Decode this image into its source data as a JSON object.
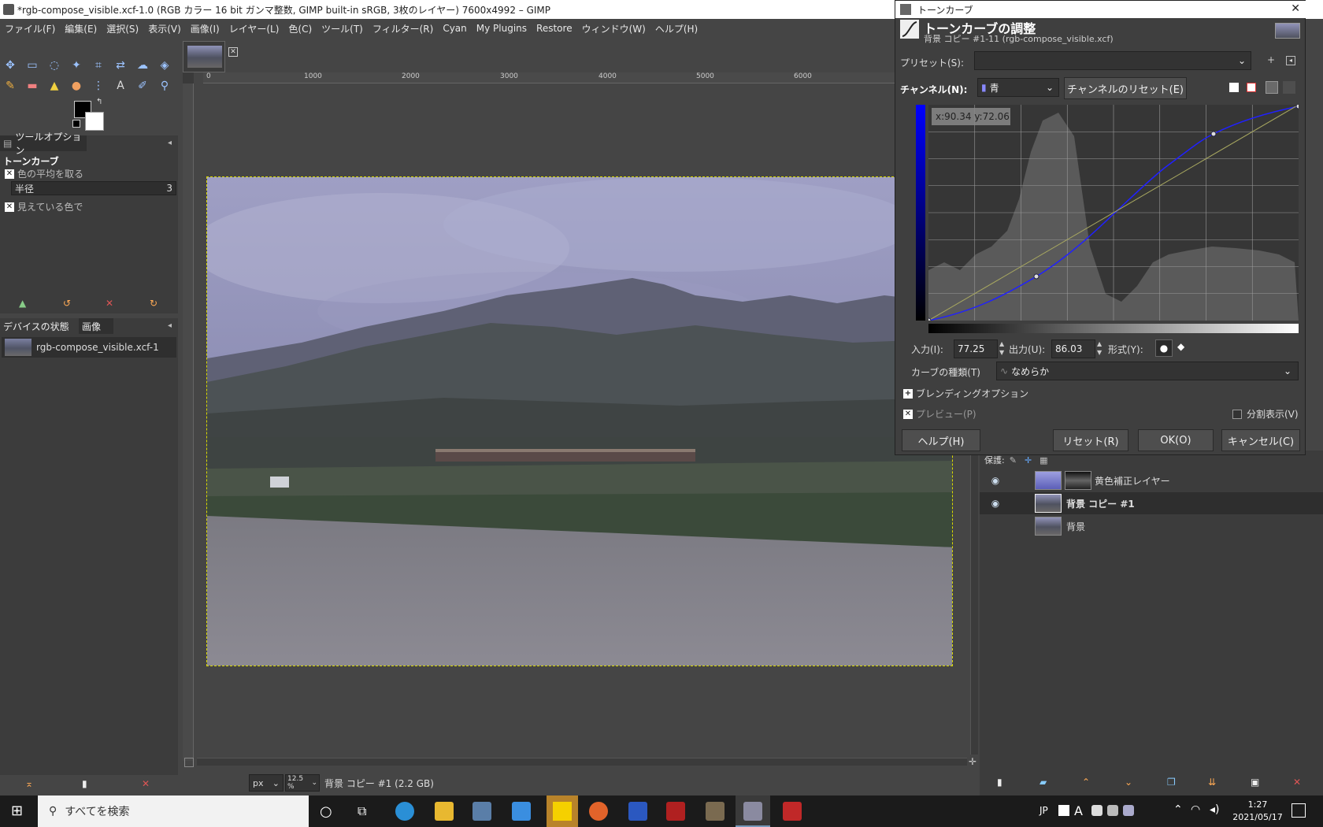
{
  "window": {
    "title": "*rgb-compose_visible.xcf-1.0 (RGB カラー 16 bit ガンマ整数, GIMP built-in sRGB, 3枚のレイヤー) 7600x4992 – GIMP"
  },
  "menu": [
    "ファイル(F)",
    "編集(E)",
    "選択(S)",
    "表示(V)",
    "画像(I)",
    "レイヤー(L)",
    "色(C)",
    "ツール(T)",
    "フィルター(R)",
    "Cyan",
    "My Plugins",
    "Restore",
    "ウィンドウ(W)",
    "ヘルプ(H)"
  ],
  "tool_options": {
    "tab_label": "ツールオプション",
    "tool_name": "トーンカーブ",
    "sample_average": "色の平均を取る",
    "radius_label": "半径",
    "radius_value": "3",
    "sample_visible": "見えている色で"
  },
  "images_panel": {
    "tab_device": "デバイスの状態",
    "tab_images": "画像",
    "image_name": "rgb-compose_visible.xcf-1"
  },
  "ruler": {
    "ticks": [
      "0",
      "1000",
      "2000",
      "3000",
      "4000",
      "5000",
      "6000"
    ]
  },
  "statusbar": {
    "unit": "px",
    "zoom": "12.5 %",
    "layer_info": "背景 コピー #1 (2.2 GB)"
  },
  "curves": {
    "window_title": "トーンカーブ",
    "heading": "トーンカーブの調整",
    "subheading": "背景 コピー #1-11 (rgb-compose_visible.xcf)",
    "preset_label": "プリセット(S):",
    "preset_value": "",
    "channel_label": "チャンネル(N):",
    "channel_value": "青",
    "channel_reset": "チャンネルのリセット(E)",
    "coord_readout": "x:90.34 y:72.06",
    "input_label": "入力(I):",
    "input_value": "77.25",
    "output_label": "出力(U):",
    "output_value": "86.03",
    "type_label": "形式(Y):",
    "curve_type_label": "カーブの種類(T)",
    "curve_type_value": "なめらか",
    "blending_label": "ブレンディングオプション",
    "preview_label": "プレビュー(P)",
    "split_label": "分割表示(V)",
    "help_button": "ヘルプ(H)",
    "reset_button": "リセット(R)",
    "ok_button": "OK(O)",
    "cancel_button": "キャンセル(C)"
  },
  "layers": {
    "lock_label": "保護:",
    "items": [
      {
        "name": "黄色補正レイヤー",
        "visible": true
      },
      {
        "name": "背景 コピー #1",
        "visible": true
      },
      {
        "name": "背景",
        "visible": false
      }
    ]
  },
  "taskbar": {
    "search_placeholder": "すべてを検索",
    "ime": "JP",
    "ime_mode": "A",
    "time": "1:27",
    "date": "2021/05/17"
  }
}
